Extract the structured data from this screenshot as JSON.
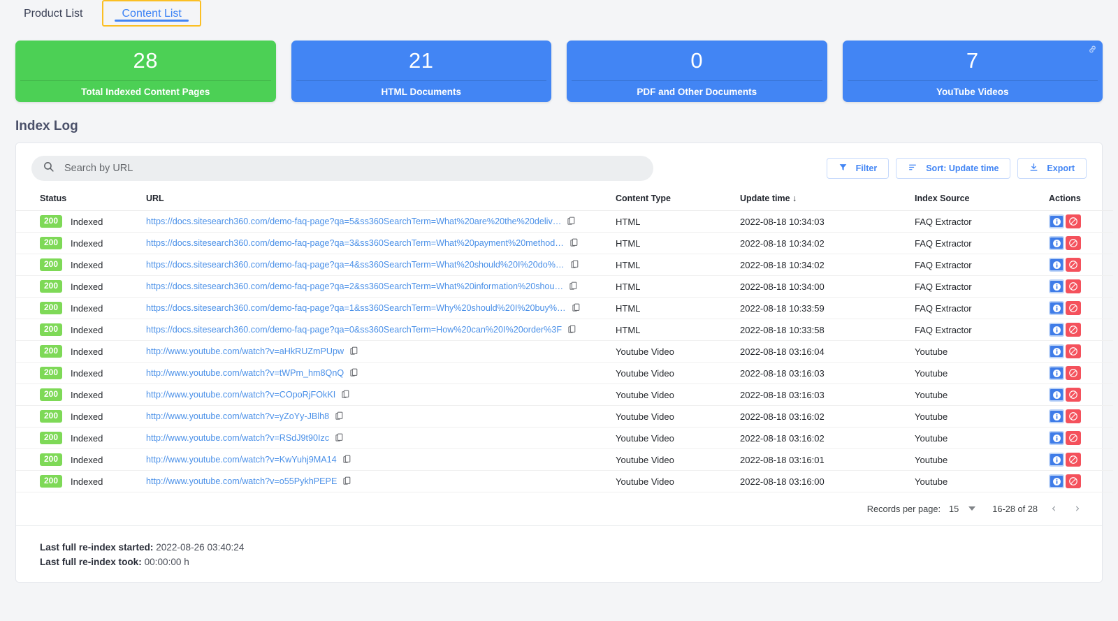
{
  "tabs": [
    {
      "label": "Product List",
      "active": false
    },
    {
      "label": "Content List",
      "active": true
    }
  ],
  "cards": [
    {
      "value": "28",
      "label": "Total Indexed Content Pages",
      "color": "#4cd055",
      "style": "green",
      "link_icon": false
    },
    {
      "value": "21",
      "label": "HTML Documents",
      "color": "#4285f4",
      "style": "blue",
      "link_icon": false
    },
    {
      "value": "0",
      "label": "PDF and Other Documents",
      "color": "#4285f4",
      "style": "blue",
      "link_icon": false
    },
    {
      "value": "7",
      "label": "YouTube Videos",
      "color": "#4285f4",
      "style": "blue",
      "link_icon": true
    }
  ],
  "section": {
    "title": "Index Log"
  },
  "search": {
    "placeholder": "Search by URL",
    "value": "",
    "icon": "search-icon"
  },
  "toolbar": {
    "filter_label": "Filter",
    "sort_label": "Sort: Update time",
    "export_label": "Export"
  },
  "table": {
    "headers": [
      "Status",
      "URL",
      "Content Type",
      "Update time",
      "Index Source",
      "Actions"
    ],
    "sort_indicator": "↓",
    "rows": [
      {
        "code": "200",
        "status": "Indexed",
        "url": "https://docs.sitesearch360.com/demo-faq-page?qa=5&ss360SearchTerm=What%20are%20the%20deliv…",
        "type": "HTML",
        "time": "2022-08-18 10:34:03",
        "source": "FAQ Extractor"
      },
      {
        "code": "200",
        "status": "Indexed",
        "url": "https://docs.sitesearch360.com/demo-faq-page?qa=3&ss360SearchTerm=What%20payment%20method…",
        "type": "HTML",
        "time": "2022-08-18 10:34:02",
        "source": "FAQ Extractor"
      },
      {
        "code": "200",
        "status": "Indexed",
        "url": "https://docs.sitesearch360.com/demo-faq-page?qa=4&ss360SearchTerm=What%20should%20I%20do%…",
        "type": "HTML",
        "time": "2022-08-18 10:34:02",
        "source": "FAQ Extractor"
      },
      {
        "code": "200",
        "status": "Indexed",
        "url": "https://docs.sitesearch360.com/demo-faq-page?qa=2&ss360SearchTerm=What%20information%20shou…",
        "type": "HTML",
        "time": "2022-08-18 10:34:00",
        "source": "FAQ Extractor"
      },
      {
        "code": "200",
        "status": "Indexed",
        "url": "https://docs.sitesearch360.com/demo-faq-page?qa=1&ss360SearchTerm=Why%20should%20I%20buy%…",
        "type": "HTML",
        "time": "2022-08-18 10:33:59",
        "source": "FAQ Extractor"
      },
      {
        "code": "200",
        "status": "Indexed",
        "url": "https://docs.sitesearch360.com/demo-faq-page?qa=0&ss360SearchTerm=How%20can%20I%20order%3F",
        "type": "HTML",
        "time": "2022-08-18 10:33:58",
        "source": "FAQ Extractor"
      },
      {
        "code": "200",
        "status": "Indexed",
        "url": "http://www.youtube.com/watch?v=aHkRUZmPUpw",
        "type": "Youtube Video",
        "time": "2022-08-18 03:16:04",
        "source": "Youtube"
      },
      {
        "code": "200",
        "status": "Indexed",
        "url": "http://www.youtube.com/watch?v=tWPm_hm8QnQ",
        "type": "Youtube Video",
        "time": "2022-08-18 03:16:03",
        "source": "Youtube"
      },
      {
        "code": "200",
        "status": "Indexed",
        "url": "http://www.youtube.com/watch?v=COpoRjFOkKI",
        "type": "Youtube Video",
        "time": "2022-08-18 03:16:03",
        "source": "Youtube"
      },
      {
        "code": "200",
        "status": "Indexed",
        "url": "http://www.youtube.com/watch?v=yZoYy-JBlh8",
        "type": "Youtube Video",
        "time": "2022-08-18 03:16:02",
        "source": "Youtube"
      },
      {
        "code": "200",
        "status": "Indexed",
        "url": "http://www.youtube.com/watch?v=RSdJ9t90Izc",
        "type": "Youtube Video",
        "time": "2022-08-18 03:16:02",
        "source": "Youtube"
      },
      {
        "code": "200",
        "status": "Indexed",
        "url": "http://www.youtube.com/watch?v=KwYuhj9MA14",
        "type": "Youtube Video",
        "time": "2022-08-18 03:16:01",
        "source": "Youtube"
      },
      {
        "code": "200",
        "status": "Indexed",
        "url": "http://www.youtube.com/watch?v=o55PykhPEPE",
        "type": "Youtube Video",
        "time": "2022-08-18 03:16:00",
        "source": "Youtube"
      }
    ]
  },
  "pagination": {
    "records_label": "Records per page:",
    "records_value": "15",
    "range": "16-28 of 28",
    "prev": "‹",
    "next": "›"
  },
  "footer": {
    "started_label": "Last full re-index started:",
    "started_value": "2022-08-26 03:40:24",
    "took_label": "Last full re-index took:",
    "took_value": "00:00:00 h"
  },
  "colors": {
    "accent_blue": "#4285f4",
    "success_green": "#4cd055",
    "badge_green": "#7ed957",
    "danger_red": "#f4515c",
    "tab_highlight": "#fbbf24",
    "page_bg": "#f4f5f7"
  }
}
